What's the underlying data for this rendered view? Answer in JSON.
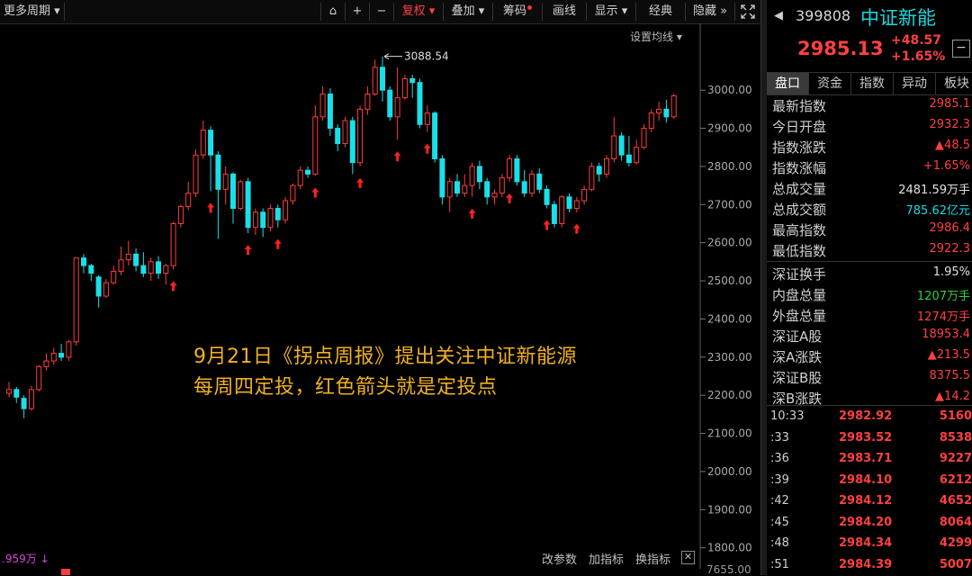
{
  "toolbar": {
    "period": "更多周期",
    "buttons": {
      "lock": "⌂",
      "zoom_in": "+",
      "zoom_out": "−",
      "fuquan": "复权",
      "overlay": "叠加",
      "chip": "筹码",
      "draw": "画线",
      "display": "显示",
      "classic": "经典",
      "hide": "隐藏",
      "more": "»"
    },
    "set_ma": "设置均线"
  },
  "annotation": {
    "line1": "9月21日《拐点周报》提出关注中证新能源",
    "line2": "每周四定投，红色箭头就是定投点"
  },
  "bottom": {
    "volume_label": ".959万",
    "change_param": "改参数",
    "add_indicator": "加指标",
    "switch_indicator": "换指标",
    "close": "✕",
    "vol_scale": "7655.00"
  },
  "panel": {
    "code": "399808",
    "name": "中证新能",
    "price": "2985.13",
    "change": "+48.57",
    "change_pct": "+1.65%",
    "minus": "−",
    "tabs": [
      "盘口",
      "资金",
      "指数",
      "异动",
      "板块"
    ],
    "quotes": [
      {
        "label": "最新指数",
        "value": "2985.1",
        "color": "r"
      },
      {
        "label": "今日开盘",
        "value": "2932.3",
        "color": "r"
      },
      {
        "label": "指数涨跌",
        "value": "▲48.5",
        "color": "r"
      },
      {
        "label": "指数涨幅",
        "value": "+1.65%",
        "color": "r"
      },
      {
        "label": "总成交量",
        "value": "2481.59万手",
        "color": "w"
      },
      {
        "label": "总成交额",
        "value": "785.62亿元",
        "color": "c"
      },
      {
        "label": "最高指数",
        "value": "2986.4",
        "color": "r"
      },
      {
        "label": "最低指数",
        "value": "2922.3",
        "color": "r"
      },
      {
        "label": "深证换手",
        "value": "1.95%",
        "color": "w"
      },
      {
        "label": "内盘总量",
        "value": "1207万手",
        "color": "g"
      },
      {
        "label": "外盘总量",
        "value": "1274万手",
        "color": "r"
      },
      {
        "label": "深证A股",
        "value": "18953.4",
        "color": "r"
      },
      {
        "label": "深A涨跌",
        "value": "▲213.5",
        "color": "r"
      },
      {
        "label": "深证B股",
        "value": "8375.5",
        "color": "r"
      },
      {
        "label": "深B涨跌",
        "value": "▲14.2",
        "color": "r"
      }
    ],
    "ticks": [
      {
        "time": "10:33",
        "price": "2982.92",
        "vol": "5160"
      },
      {
        "time": ":33",
        "price": "2983.52",
        "vol": "8538"
      },
      {
        "time": ":36",
        "price": "2983.71",
        "vol": "9227"
      },
      {
        "time": ":39",
        "price": "2984.10",
        "vol": "6212"
      },
      {
        "time": ":42",
        "price": "2984.12",
        "vol": "4652"
      },
      {
        "time": ":45",
        "price": "2984.20",
        "vol": "8064"
      },
      {
        "time": ":48",
        "price": "2984.34",
        "vol": "4299"
      },
      {
        "time": ":51",
        "price": "2984.39",
        "vol": "5007"
      }
    ]
  },
  "chart_data": {
    "type": "candlestick",
    "y_ticks": [
      3000,
      2900,
      2800,
      2700,
      2600,
      2500,
      2400,
      2300,
      2200,
      2100,
      2000,
      1900,
      1800
    ],
    "y_tick_labels": [
      "3000.00",
      "2900.00",
      "2800.00",
      "2700.00",
      "2600.00",
      "2500.00",
      "2400.00",
      "2300.00",
      "2200.00",
      "2100.00",
      "2000.00",
      "1900.00",
      "1800.00"
    ],
    "ylim": [
      1745,
      3175
    ],
    "high_label": "3088.54",
    "high_value": 3088.54,
    "up_color": "#ff3b3b",
    "down_color": "#19e0e8",
    "candles": [
      [
        2205,
        2215,
        2235,
        2195
      ],
      [
        2215,
        2195,
        2222,
        2180
      ],
      [
        2192,
        2165,
        2200,
        2140
      ],
      [
        2165,
        2215,
        2225,
        2160
      ],
      [
        2215,
        2275,
        2280,
        2210
      ],
      [
        2275,
        2290,
        2310,
        2265
      ],
      [
        2290,
        2310,
        2325,
        2280
      ],
      [
        2310,
        2300,
        2335,
        2290
      ],
      [
        2300,
        2340,
        2345,
        2290
      ],
      [
        2340,
        2560,
        2560,
        2330
      ],
      [
        2560,
        2540,
        2570,
        2520
      ],
      [
        2540,
        2520,
        2545,
        2500
      ],
      [
        2510,
        2460,
        2515,
        2430
      ],
      [
        2460,
        2495,
        2505,
        2455
      ],
      [
        2495,
        2525,
        2540,
        2490
      ],
      [
        2525,
        2555,
        2590,
        2515
      ],
      [
        2555,
        2570,
        2605,
        2540
      ],
      [
        2570,
        2540,
        2585,
        2525
      ],
      [
        2540,
        2520,
        2575,
        2510
      ],
      [
        2520,
        2550,
        2560,
        2500
      ],
      [
        2550,
        2520,
        2565,
        2505
      ],
      [
        2520,
        2540,
        2545,
        2490
      ],
      [
        2540,
        2650,
        2655,
        2530
      ],
      [
        2650,
        2695,
        2700,
        2640
      ],
      [
        2695,
        2730,
        2760,
        2685
      ],
      [
        2730,
        2830,
        2845,
        2720
      ],
      [
        2830,
        2895,
        2920,
        2820
      ],
      [
        2895,
        2830,
        2905,
        2735
      ],
      [
        2830,
        2740,
        2840,
        2610
      ],
      [
        2740,
        2780,
        2800,
        2700
      ],
      [
        2780,
        2690,
        2785,
        2650
      ],
      [
        2690,
        2760,
        2765,
        2685
      ],
      [
        2760,
        2640,
        2770,
        2625
      ],
      [
        2640,
        2680,
        2690,
        2620
      ],
      [
        2680,
        2640,
        2690,
        2615
      ],
      [
        2640,
        2690,
        2700,
        2630
      ],
      [
        2690,
        2660,
        2700,
        2640
      ],
      [
        2660,
        2710,
        2720,
        2650
      ],
      [
        2710,
        2750,
        2755,
        2700
      ],
      [
        2750,
        2790,
        2800,
        2740
      ],
      [
        2790,
        2780,
        2800,
        2770
      ],
      [
        2780,
        2930,
        2960,
        2775
      ],
      [
        2930,
        2990,
        3010,
        2920
      ],
      [
        2990,
        2900,
        3005,
        2880
      ],
      [
        2900,
        2860,
        2910,
        2840
      ],
      [
        2860,
        2920,
        2930,
        2850
      ],
      [
        2920,
        2810,
        2930,
        2780
      ],
      [
        2810,
        2950,
        2960,
        2800
      ],
      [
        2950,
        2990,
        3010,
        2935
      ],
      [
        2990,
        3060,
        3080,
        2985
      ],
      [
        3060,
        3000,
        3088,
        2970
      ],
      [
        3000,
        2930,
        3010,
        2920
      ],
      [
        2930,
        2980,
        3060,
        2870
      ],
      [
        2980,
        3030,
        3040,
        2975
      ],
      [
        3030,
        3020,
        3040,
        2980
      ],
      [
        3020,
        2910,
        3030,
        2900
      ],
      [
        2910,
        2940,
        2960,
        2890
      ],
      [
        2940,
        2820,
        2945,
        2810
      ],
      [
        2820,
        2720,
        2830,
        2700
      ],
      [
        2720,
        2760,
        2770,
        2680
      ],
      [
        2760,
        2730,
        2780,
        2720
      ],
      [
        2730,
        2750,
        2780,
        2720
      ],
      [
        2750,
        2800,
        2810,
        2720
      ],
      [
        2800,
        2760,
        2815,
        2740
      ],
      [
        2760,
        2720,
        2770,
        2700
      ],
      [
        2720,
        2730,
        2740,
        2700
      ],
      [
        2730,
        2770,
        2780,
        2720
      ],
      [
        2770,
        2820,
        2830,
        2760
      ],
      [
        2820,
        2760,
        2830,
        2750
      ],
      [
        2760,
        2730,
        2790,
        2720
      ],
      [
        2730,
        2780,
        2790,
        2720
      ],
      [
        2780,
        2740,
        2795,
        2730
      ],
      [
        2740,
        2700,
        2750,
        2690
      ],
      [
        2700,
        2650,
        2710,
        2640
      ],
      [
        2650,
        2720,
        2725,
        2640
      ],
      [
        2720,
        2690,
        2730,
        2680
      ],
      [
        2690,
        2710,
        2720,
        2680
      ],
      [
        2710,
        2740,
        2750,
        2700
      ],
      [
        2740,
        2800,
        2810,
        2735
      ],
      [
        2800,
        2780,
        2810,
        2760
      ],
      [
        2780,
        2820,
        2830,
        2770
      ],
      [
        2820,
        2880,
        2930,
        2810
      ],
      [
        2880,
        2830,
        2890,
        2815
      ],
      [
        2830,
        2810,
        2880,
        2800
      ],
      [
        2810,
        2850,
        2870,
        2805
      ],
      [
        2850,
        2900,
        2910,
        2845
      ],
      [
        2900,
        2940,
        2950,
        2890
      ],
      [
        2940,
        2950,
        2970,
        2920
      ],
      [
        2950,
        2930,
        2975,
        2915
      ],
      [
        2930,
        2985,
        2990,
        2925
      ]
    ],
    "arrows": [
      22,
      27,
      32,
      36,
      41,
      47,
      52,
      56,
      62,
      67,
      72,
      76
    ]
  }
}
